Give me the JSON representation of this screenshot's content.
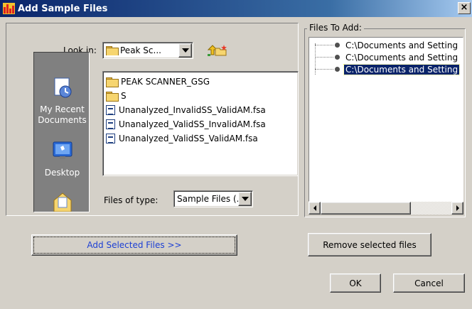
{
  "window": {
    "title": "Add Sample Files",
    "close_glyph": "×"
  },
  "chooser": {
    "look_in_label": "Look in:",
    "look_in_value": "Peak Sc...",
    "up_icon": "up-folder-icon",
    "new_folder_icon": "new-folder-icon",
    "places": [
      {
        "label_line1": "My Recent",
        "label_line2": "Documents",
        "icon": "recent-documents-icon"
      },
      {
        "label_line1": "Desktop",
        "label_line2": "",
        "icon": "desktop-icon"
      },
      {
        "label_line1": "",
        "label_line2": "",
        "icon": "my-documents-icon"
      }
    ],
    "files": [
      {
        "name": "PEAK SCANNER_GSG",
        "icon": "folder-icon"
      },
      {
        "name": "S",
        "icon": "folder-icon"
      },
      {
        "name": "Unanalyzed_InvalidSS_ValidAM.fsa",
        "icon": "fsa-file-icon"
      },
      {
        "name": "Unanalyzed_ValidSS_InvalidAM.fsa",
        "icon": "fsa-file-icon"
      },
      {
        "name": "Unanalyzed_ValidSS_ValidAM.fsa",
        "icon": "fsa-file-icon"
      }
    ],
    "files_of_type_label": "Files of type:",
    "files_of_type_value": "Sample Files (..."
  },
  "files_to_add": {
    "title": "Files To Add:",
    "items": [
      {
        "path": "C:\\Documents and Setting",
        "selected": false
      },
      {
        "path": "C:\\Documents and Setting",
        "selected": false
      },
      {
        "path": "C:\\Documents and Setting",
        "selected": true
      }
    ]
  },
  "buttons": {
    "add_selected": "Add Selected Files >>",
    "remove_selected": "Remove selected files",
    "ok": "OK",
    "cancel": "Cancel"
  },
  "colors": {
    "title_start": "#0a246a",
    "title_end": "#a6caf0",
    "selection": "#0a246a",
    "link_blue": "#1c3fd4"
  }
}
